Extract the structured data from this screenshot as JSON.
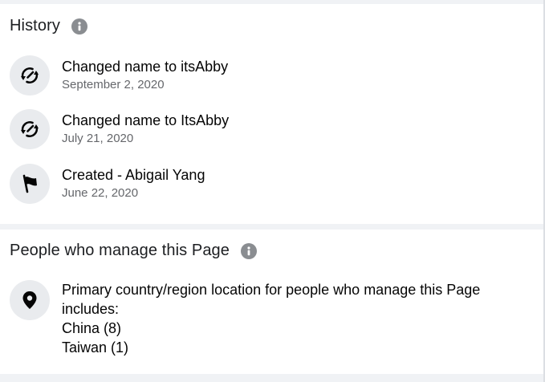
{
  "history": {
    "title": "History",
    "items": [
      {
        "icon": "edit-name-icon",
        "text": "Changed name to itsAbby",
        "date": "September 2, 2020"
      },
      {
        "icon": "edit-name-icon",
        "text": "Changed name to ItsAbby",
        "date": "July 21, 2020"
      },
      {
        "icon": "flag-icon",
        "text": "Created - Abigail Yang",
        "date": "June 22, 2020"
      }
    ]
  },
  "managers": {
    "title": "People who manage this Page",
    "icon": "location-pin-icon",
    "description": "Primary country/region location for people who manage this Page includes:",
    "countries": [
      {
        "label": "China (8)"
      },
      {
        "label": "Taiwan (1)"
      }
    ]
  },
  "colors": {
    "background": "#f0f2f5",
    "card": "#ffffff",
    "icon_circle": "#e9ebee",
    "secondary_text": "#65676b",
    "info_icon": "#8a8d91"
  }
}
